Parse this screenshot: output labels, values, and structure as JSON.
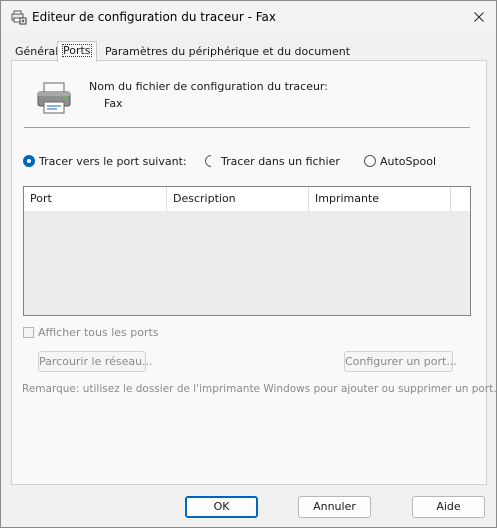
{
  "window": {
    "title": "Editeur de configuration du traceur - Fax",
    "icon": "plotter-config-icon",
    "close_glyph": "✕"
  },
  "tabs": [
    {
      "label": "Général",
      "active": false
    },
    {
      "label": "Ports",
      "active": true
    },
    {
      "label": "Paramètres du périphérique et du document",
      "active": false
    }
  ],
  "ports_tab": {
    "file_label": "Nom du fichier de configuration du traceur:",
    "file_value": "Fax",
    "radio_options": [
      {
        "label": "Tracer vers le port suivant:",
        "checked": true
      },
      {
        "label": "Tracer dans un fichier",
        "checked": false
      },
      {
        "label": "AutoSpool",
        "checked": false
      }
    ],
    "list_columns": [
      "Port",
      "Description",
      "Imprimante"
    ],
    "list_rows": [],
    "show_all_ports_label": "Afficher tous les ports",
    "show_all_ports_checked": false,
    "browse_network_label": "Parcourir le réseau...",
    "configure_port_label": "Configurer un port...",
    "note": "Remarque: utilisez le dossier de l'imprimante Windows pour ajouter ou supprimer un port."
  },
  "footer": {
    "ok_label": "OK",
    "cancel_label": "Annuler",
    "help_label": "Aide"
  },
  "colors": {
    "accent": "#0067c0",
    "disabled_text": "#8a8a8a"
  }
}
